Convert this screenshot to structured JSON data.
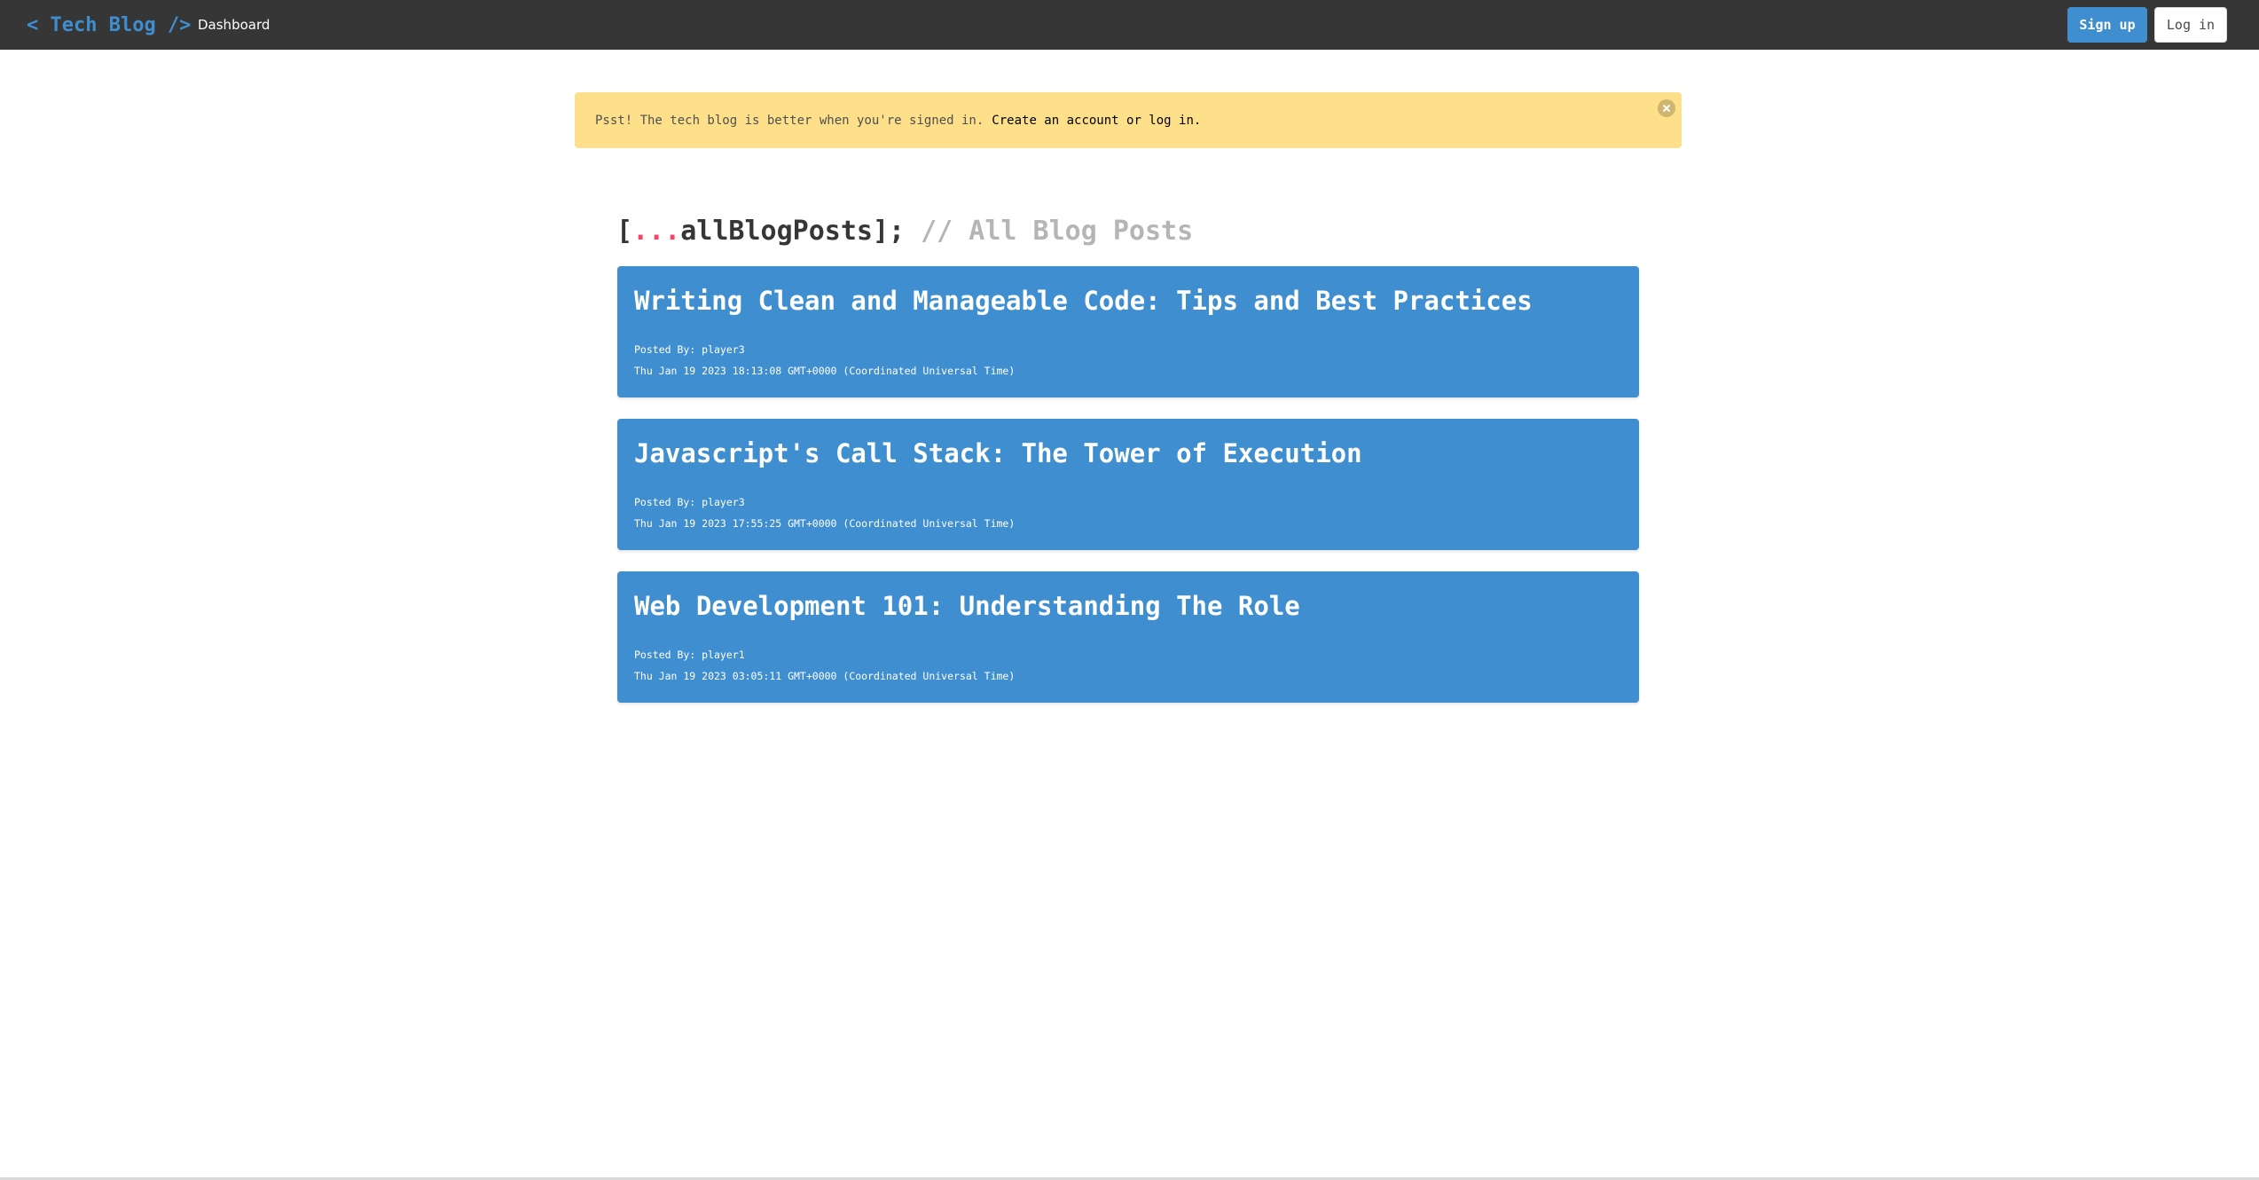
{
  "navbar": {
    "brand": "< Tech Blog />",
    "dashboard": "Dashboard",
    "signup": "Sign up",
    "login": "Log in"
  },
  "notification": {
    "text": "Psst! The tech blog is better when you're signed in.",
    "link": "Create an account or log in."
  },
  "heading": {
    "open_bracket": "[",
    "spread": "...",
    "name": "allBlogPosts];",
    "comment": "// All Blog Posts"
  },
  "posts": [
    {
      "title": "Writing Clean and Manageable Code: Tips and Best Practices",
      "author": "Posted By: player3",
      "date": "Thu Jan 19 2023 18:13:08 GMT+0000 (Coordinated Universal Time)"
    },
    {
      "title": "Javascript's Call Stack: The Tower of Execution",
      "author": "Posted By: player3",
      "date": "Thu Jan 19 2023 17:55:25 GMT+0000 (Coordinated Universal Time)"
    },
    {
      "title": "Web Development 101: Understanding The Role",
      "author": "Posted By: player1",
      "date": "Thu Jan 19 2023 03:05:11 GMT+0000 (Coordinated Universal Time)"
    }
  ],
  "colors": {
    "navbar": "#363636",
    "primary": "#3e8ed0",
    "warning": "#ffe08a",
    "danger": "#f14668",
    "comment": "#b5b5b5"
  },
  "icons": {
    "notification_close": "close-icon"
  }
}
